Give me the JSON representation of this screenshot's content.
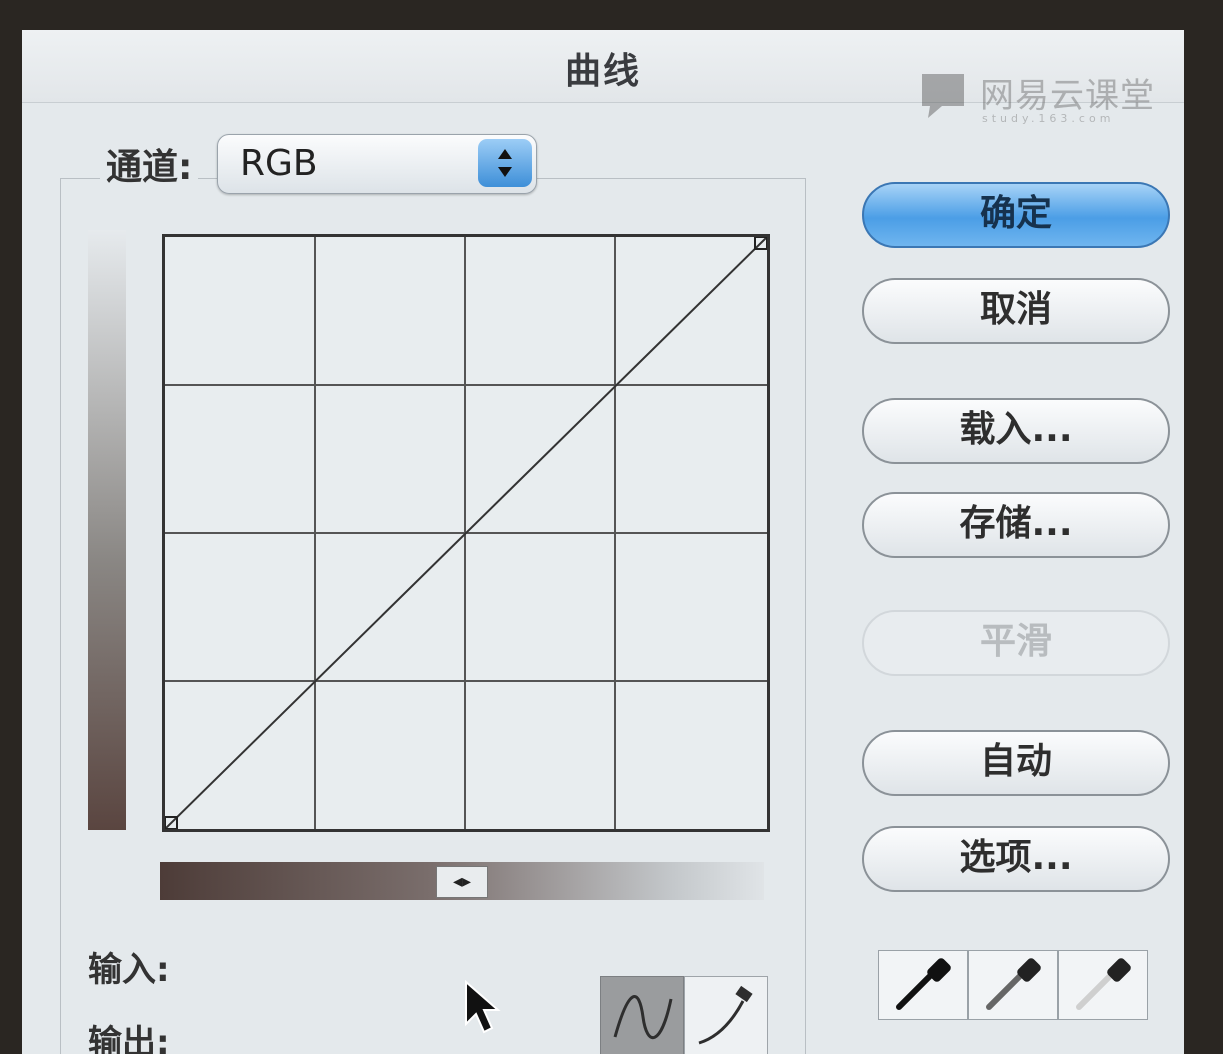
{
  "dialog": {
    "title": "曲线"
  },
  "watermark": {
    "name": "网易云课堂",
    "sub": "study.163.com"
  },
  "channel": {
    "label": "通道:",
    "value": "RGB"
  },
  "curve": {
    "points": [
      [
        0,
        0
      ],
      [
        255,
        255
      ]
    ],
    "grid_divisions": 4
  },
  "buttons": {
    "ok": "确定",
    "cancel": "取消",
    "load": "载入...",
    "save": "存储...",
    "smooth": "平滑",
    "auto": "自动",
    "options": "选项..."
  },
  "fields": {
    "input_label": "输入:",
    "output_label": "输出:"
  },
  "icons": {
    "select_arrows": "up-down-arrows-icon",
    "gradient_toggle": "left-right-arrows-icon",
    "pointer": "arrow-pointer-icon",
    "curve_mode": "curve-tool-icon",
    "pencil_mode": "pencil-tool-icon",
    "droppers": [
      "black-point-eyedropper-icon",
      "gray-point-eyedropper-icon",
      "white-point-eyedropper-icon"
    ]
  },
  "colors": {
    "accent": "#4b9ee6",
    "background": "#e4e9ec"
  }
}
